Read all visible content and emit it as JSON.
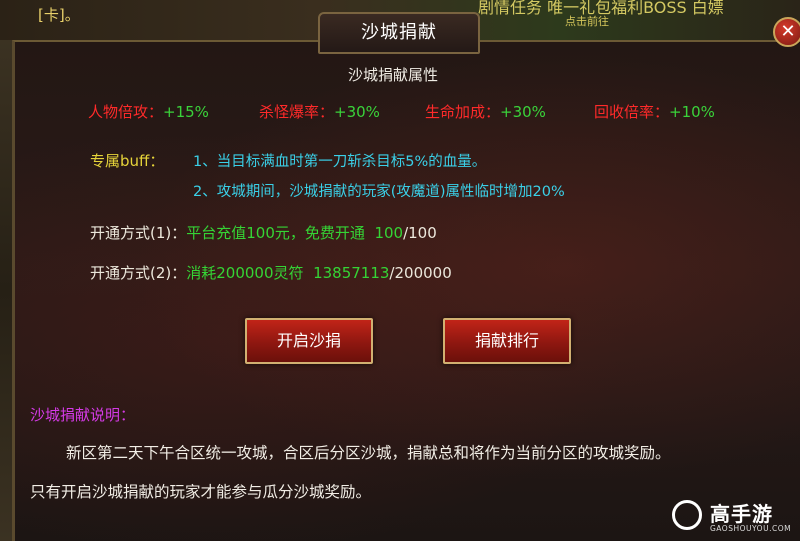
{
  "background": {
    "left_text": "[卡]。",
    "right_text": "剧情任务 唯一礼包福利BOSS 白嫖",
    "small_text": "点击前往"
  },
  "dialog": {
    "title": "沙城捐献",
    "close_icon": "close-icon",
    "subtitle": "沙城捐献属性",
    "attributes": [
      {
        "label": "人物倍攻：",
        "value": "+15%"
      },
      {
        "label": "杀怪爆率：",
        "value": "+30%"
      },
      {
        "label": "生命加成：",
        "value": "+30%"
      },
      {
        "label": "回收倍率：",
        "value": "+10%"
      }
    ],
    "buff": {
      "label": "专属buff：",
      "lines": [
        "1、当目标满血时第一刀斩杀目标5%的血量。",
        "2、攻城期间，沙城捐献的玩家(攻魔道)属性临时增加20%"
      ]
    },
    "methods": [
      {
        "label": "开通方式(1)：",
        "desc": "平台充值100元，免费开通",
        "progress_current": "100",
        "progress_total": "/100"
      },
      {
        "label": "开通方式(2)：",
        "desc": "消耗200000灵符",
        "progress_current": "13857113",
        "progress_total": "/200000"
      }
    ],
    "buttons": {
      "open": "开启沙捐",
      "ranking": "捐献排行"
    },
    "description": {
      "title": "沙城捐献说明：",
      "lines": [
        "新区第二天下午合区统一攻城，合区后分区沙城，捐献总和将作为当前分区的攻城奖励。",
        "只有开启沙城捐献的玩家才能参与瓜分沙城奖励。"
      ]
    }
  },
  "watermark": {
    "name": "高手游",
    "domain": "GAOSHOUYOU.COM"
  },
  "colors": {
    "attr_label": "#ff2a2a",
    "attr_value": "#3ad23a",
    "buff_label": "#e6d43a",
    "buff_text": "#3ad0e8",
    "desc_title": "#d43ae6",
    "button_red": "#8e1710"
  }
}
